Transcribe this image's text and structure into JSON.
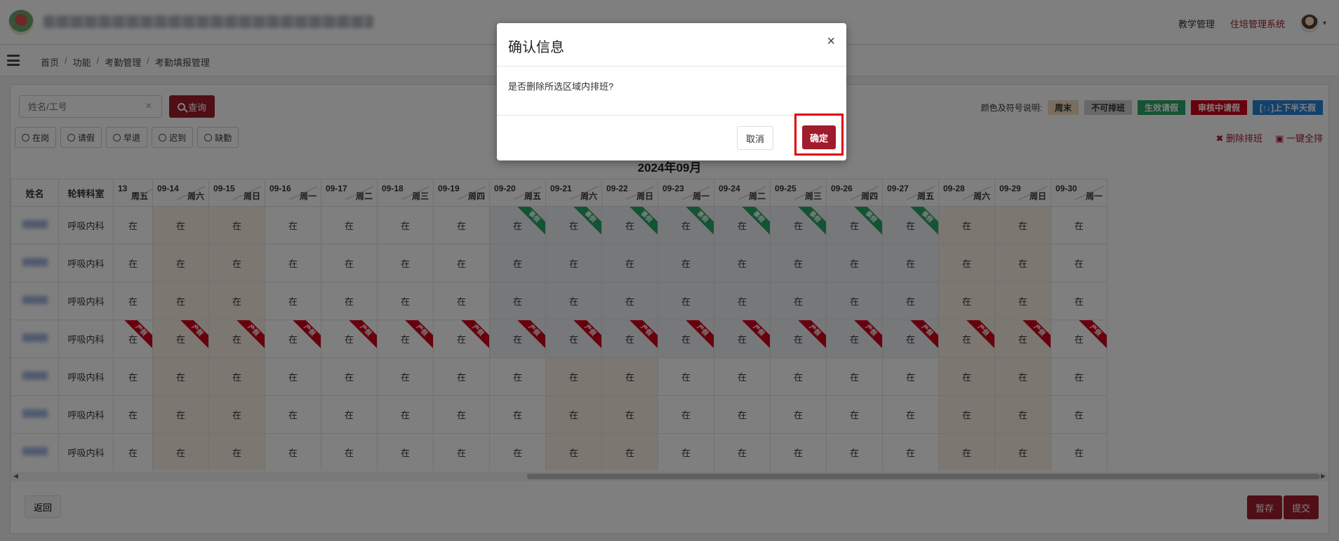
{
  "topbar": {
    "nav": [
      "教学管理",
      "住培管理系统"
    ],
    "active_nav": "住培管理系统"
  },
  "breadcrumb": [
    "首页",
    "功能",
    "考勤管理",
    "考勤填报管理"
  ],
  "search": {
    "placeholder": "姓名/工号",
    "button": "查询"
  },
  "filters": [
    "在岗",
    "请假",
    "早退",
    "迟到",
    "缺勤"
  ],
  "legend": {
    "label": "颜色及符号说明:",
    "items": [
      "周末",
      "不可排班",
      "生效请假",
      "审核中请假",
      "[↑↓]上下半天假"
    ]
  },
  "actions": {
    "delete": "删除排班",
    "fill_all": "一键全排"
  },
  "month_title": "2024年09月",
  "table": {
    "col_name": "姓名",
    "col_dept": "轮转科室",
    "days": [
      {
        "date": "13",
        "weekday": "周五"
      },
      {
        "date": "09-14",
        "weekday": "周六"
      },
      {
        "date": "09-15",
        "weekday": "周日"
      },
      {
        "date": "09-16",
        "weekday": "周一"
      },
      {
        "date": "09-17",
        "weekday": "周二"
      },
      {
        "date": "09-18",
        "weekday": "周三"
      },
      {
        "date": "09-19",
        "weekday": "周四"
      },
      {
        "date": "09-20",
        "weekday": "周五"
      },
      {
        "date": "09-21",
        "weekday": "周六"
      },
      {
        "date": "09-22",
        "weekday": "周日"
      },
      {
        "date": "09-23",
        "weekday": "周一"
      },
      {
        "date": "09-24",
        "weekday": "周二"
      },
      {
        "date": "09-25",
        "weekday": "周三"
      },
      {
        "date": "09-26",
        "weekday": "周四"
      },
      {
        "date": "09-27",
        "weekday": "周五"
      },
      {
        "date": "09-28",
        "weekday": "周六"
      },
      {
        "date": "09-29",
        "weekday": "周日"
      },
      {
        "date": "09-30",
        "weekday": "周一"
      }
    ],
    "rows": [
      {
        "dept": "呼吸内科"
      },
      {
        "dept": "呼吸内科"
      },
      {
        "dept": "呼吸内科"
      },
      {
        "dept": "呼吸内科"
      },
      {
        "dept": "呼吸内科"
      },
      {
        "dept": "呼吸内科"
      },
      {
        "dept": "呼吸内科"
      }
    ],
    "cell_value": "在",
    "ribbon_sick": "事假",
    "ribbon_maternity": "产假"
  },
  "footer": {
    "back": "返回",
    "save": "暂存",
    "submit": "提交"
  },
  "modal": {
    "title": "确认信息",
    "close": "×",
    "message": "是否删除所选区域内排班?",
    "cancel": "取消",
    "confirm": "确定"
  }
}
